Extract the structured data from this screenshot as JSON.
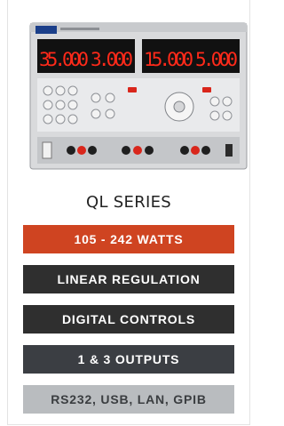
{
  "product": {
    "series_title": "QL SERIES",
    "image_alt": "QL series power supply front panel",
    "display_values": [
      "35.000",
      "3.000",
      "15.000",
      "5.000"
    ]
  },
  "features": [
    {
      "label": "105 - 242 WATTS",
      "bg": "#cf4421",
      "fg": "#ffffff"
    },
    {
      "label": "LINEAR REGULATION",
      "bg": "#2f2f2f",
      "fg": "#ffffff"
    },
    {
      "label": "DIGITAL CONTROLS",
      "bg": "#2f2f2f",
      "fg": "#ffffff"
    },
    {
      "label": "1 & 3 OUTPUTS",
      "bg": "#3b3e43",
      "fg": "#ffffff"
    },
    {
      "label": "RS232, USB, LAN, GPIB",
      "bg": "#b9bcbf",
      "fg": "#3a3d40"
    }
  ]
}
